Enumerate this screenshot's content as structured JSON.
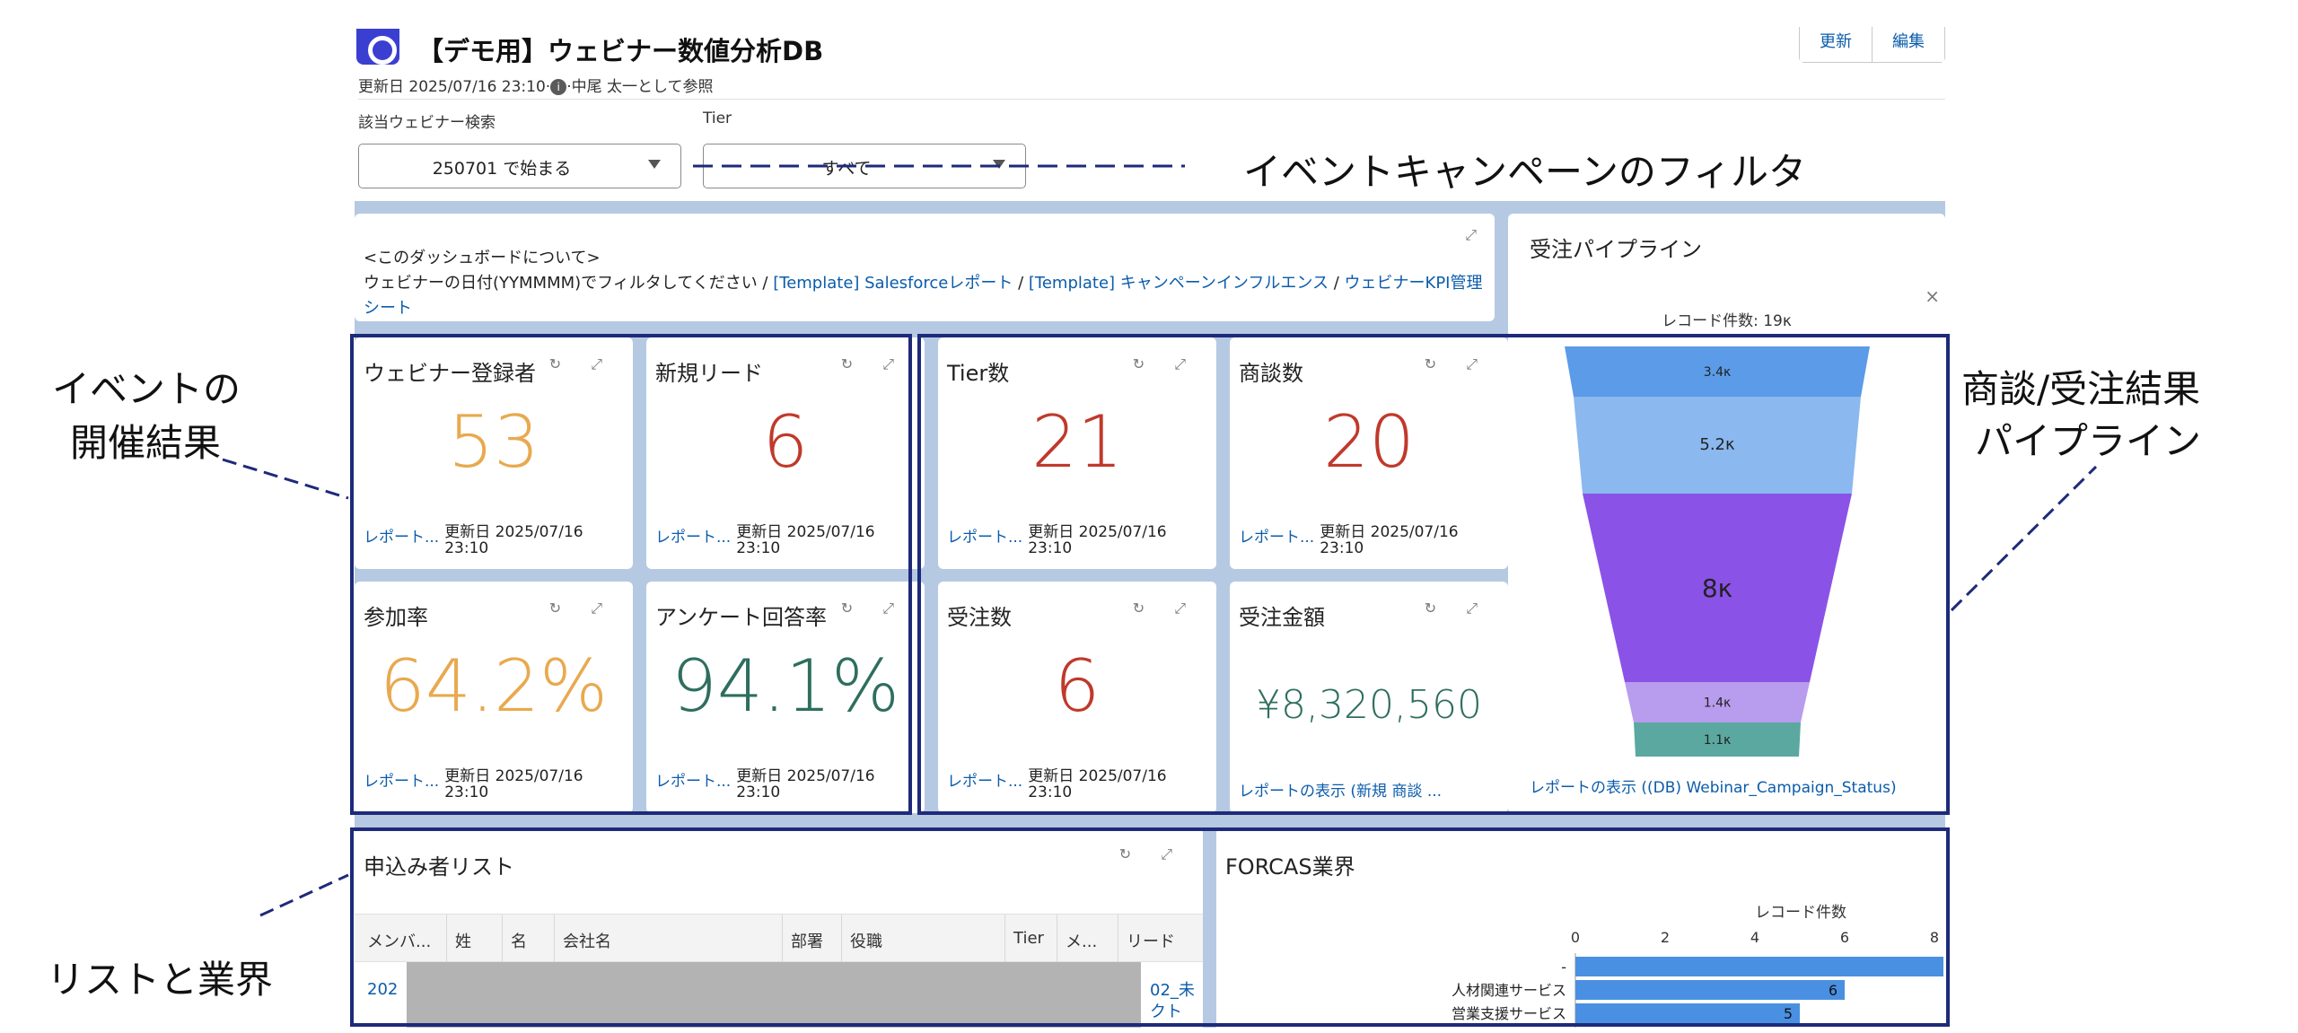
{
  "dashboard": {
    "title": "【デモ用】ウェビナー数値分析DB",
    "subtitle_prefix": "更新日 2025/07/16 23:10·",
    "subtitle_info_icon": "i",
    "subtitle_suffix": "·中尾 太一として参照",
    "buttons": {
      "refresh": "更新",
      "edit": "編集"
    }
  },
  "filters": {
    "webinar": {
      "label": "該当ウェビナー検索",
      "value": "250701 で始まる"
    },
    "tier": {
      "label": "Tier",
      "value": "すべて"
    }
  },
  "about": {
    "heading": "<このダッシュボードについて>",
    "line_prefix": "ウェビナーの日付(YYMMMM)でフィルタしてください / ",
    "link1": "[Template] Salesforceレポート",
    "sep1": " / ",
    "link2": "[Template] キャンペーンインフルエンス",
    "sep2": " / ",
    "link3": "ウェビナーKPI管理シート"
  },
  "metrics": [
    {
      "title": "ウェビナー登録者",
      "value": "53",
      "color": "#e8a94e",
      "link": "レポート...",
      "updated": "更新日 2025/07/16",
      "updated2": "23:10"
    },
    {
      "title": "新規リード",
      "value": "6",
      "color": "#c0392b",
      "link": "レポート...",
      "updated": "更新日 2025/07/16",
      "updated2": "23:10"
    },
    {
      "title": "Tier数",
      "value": "21",
      "color": "#c0392b",
      "link": "レポート...",
      "updated": "更新日 2025/07/16",
      "updated2": "23:10"
    },
    {
      "title": "商談数",
      "value": "20",
      "color": "#c0392b",
      "link": "レポート...",
      "updated": "更新日 2025/07/16",
      "updated2": "23:10"
    },
    {
      "title": "参加率",
      "value": "64.2%",
      "color": "#e8a94e",
      "link": "レポート...",
      "updated": "更新日 2025/07/16",
      "updated2": "23:10"
    },
    {
      "title": "アンケート回答率",
      "value": "94.1%",
      "color": "#2e6e5e",
      "link": "レポート...",
      "updated": "更新日 2025/07/16",
      "updated2": "23:10"
    },
    {
      "title": "受注数",
      "value": "6",
      "color": "#c0392b",
      "link": "レポート...",
      "updated": "更新日 2025/07/16",
      "updated2": "23:10"
    },
    {
      "title": "受注金額",
      "value": "¥8,320,560",
      "color": "#2e6e5e",
      "link": "レポートの表示 (新規 商談 ...",
      "updated": "",
      "updated2": ""
    }
  ],
  "pipeline": {
    "title": "受注パイプライン",
    "record_count": "レコード件数: 19κ",
    "close_icon": "×",
    "link": "レポートの表示 ((DB) Webinar_Campaign_Status)",
    "segments": [
      {
        "label": "3.4κ",
        "value": 3400,
        "color": "#5b9be8"
      },
      {
        "label": "5.2κ",
        "value": 5200,
        "color": "#8ab8ef"
      },
      {
        "label": "8κ",
        "value": 8000,
        "color": "#8b52e8"
      },
      {
        "label": "1.4κ",
        "value": 1400,
        "color": "#b89cee"
      },
      {
        "label": "1.1κ",
        "value": 1100,
        "color": "#5ba8a0"
      }
    ]
  },
  "applicants": {
    "title": "申込み者リスト",
    "columns": [
      "メンバ...",
      "姓",
      "名",
      "会社名",
      "部署",
      "役職",
      "Tier",
      "メ...",
      "リード"
    ],
    "first_cell": "202",
    "last_cell_line1": "02_未",
    "last_cell_line2": "クト"
  },
  "industry": {
    "title": "FORCAS業界",
    "axis_title": "レコード件数",
    "ticks": [
      "0",
      "2",
      "4",
      "6",
      "8"
    ],
    "rows": [
      {
        "label": "-",
        "value": 8.2,
        "show": ""
      },
      {
        "label": "人材関連サービス",
        "value": 6,
        "show": "6"
      },
      {
        "label": "営業支援サービス",
        "value": 5,
        "show": "5"
      }
    ]
  },
  "annotations": {
    "filter": "イベントキャンペーンのフィルタ",
    "event_result_1": "イベントの",
    "event_result_2": "開催結果",
    "pipeline_1": "商談/受注結果",
    "pipeline_2": "パイプライン",
    "list": "リストと業界"
  },
  "colors": {
    "link": "#0b5cab",
    "highlight": "#1e2a7a",
    "canvas": "#b6c9e2"
  }
}
